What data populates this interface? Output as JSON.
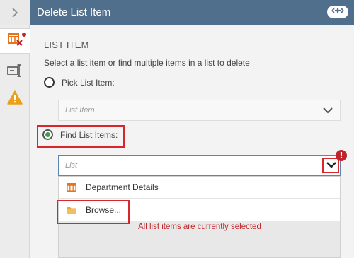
{
  "rail": {
    "toggle_icon": "chevron-right-icon",
    "tabs": [
      {
        "icon": "list-item-delete-icon",
        "active": true,
        "has_alert_dot": true
      },
      {
        "icon": "text-cursor-icon",
        "active": false
      },
      {
        "icon": "warning-icon",
        "active": false
      }
    ]
  },
  "header": {
    "title": "Delete List Item",
    "action_icon": "add-toggle-icon"
  },
  "form": {
    "section_title": "LIST ITEM",
    "description": "Select a list item or find multiple items in a list to delete",
    "option_pick": {
      "label": "Pick List Item:",
      "selected": false
    },
    "pick_dropdown": {
      "placeholder": "List Item"
    },
    "option_find": {
      "label": "Find List Items:",
      "selected": true
    },
    "find_dropdown": {
      "placeholder": "List",
      "error_badge": "!"
    },
    "list_items": [
      {
        "label": "Department Details",
        "icon": "list-grid-icon"
      },
      {
        "label": "Browse...",
        "icon": "folder-icon"
      }
    ],
    "error_message": "All list items are currently selected"
  },
  "colors": {
    "header_bg": "#4f6f8c",
    "selected_radio": "#3aa346",
    "error": "#c0242a",
    "highlight": "#d9262c",
    "list_icon": "#e8741a",
    "folder_icon": "#e9a53a"
  }
}
